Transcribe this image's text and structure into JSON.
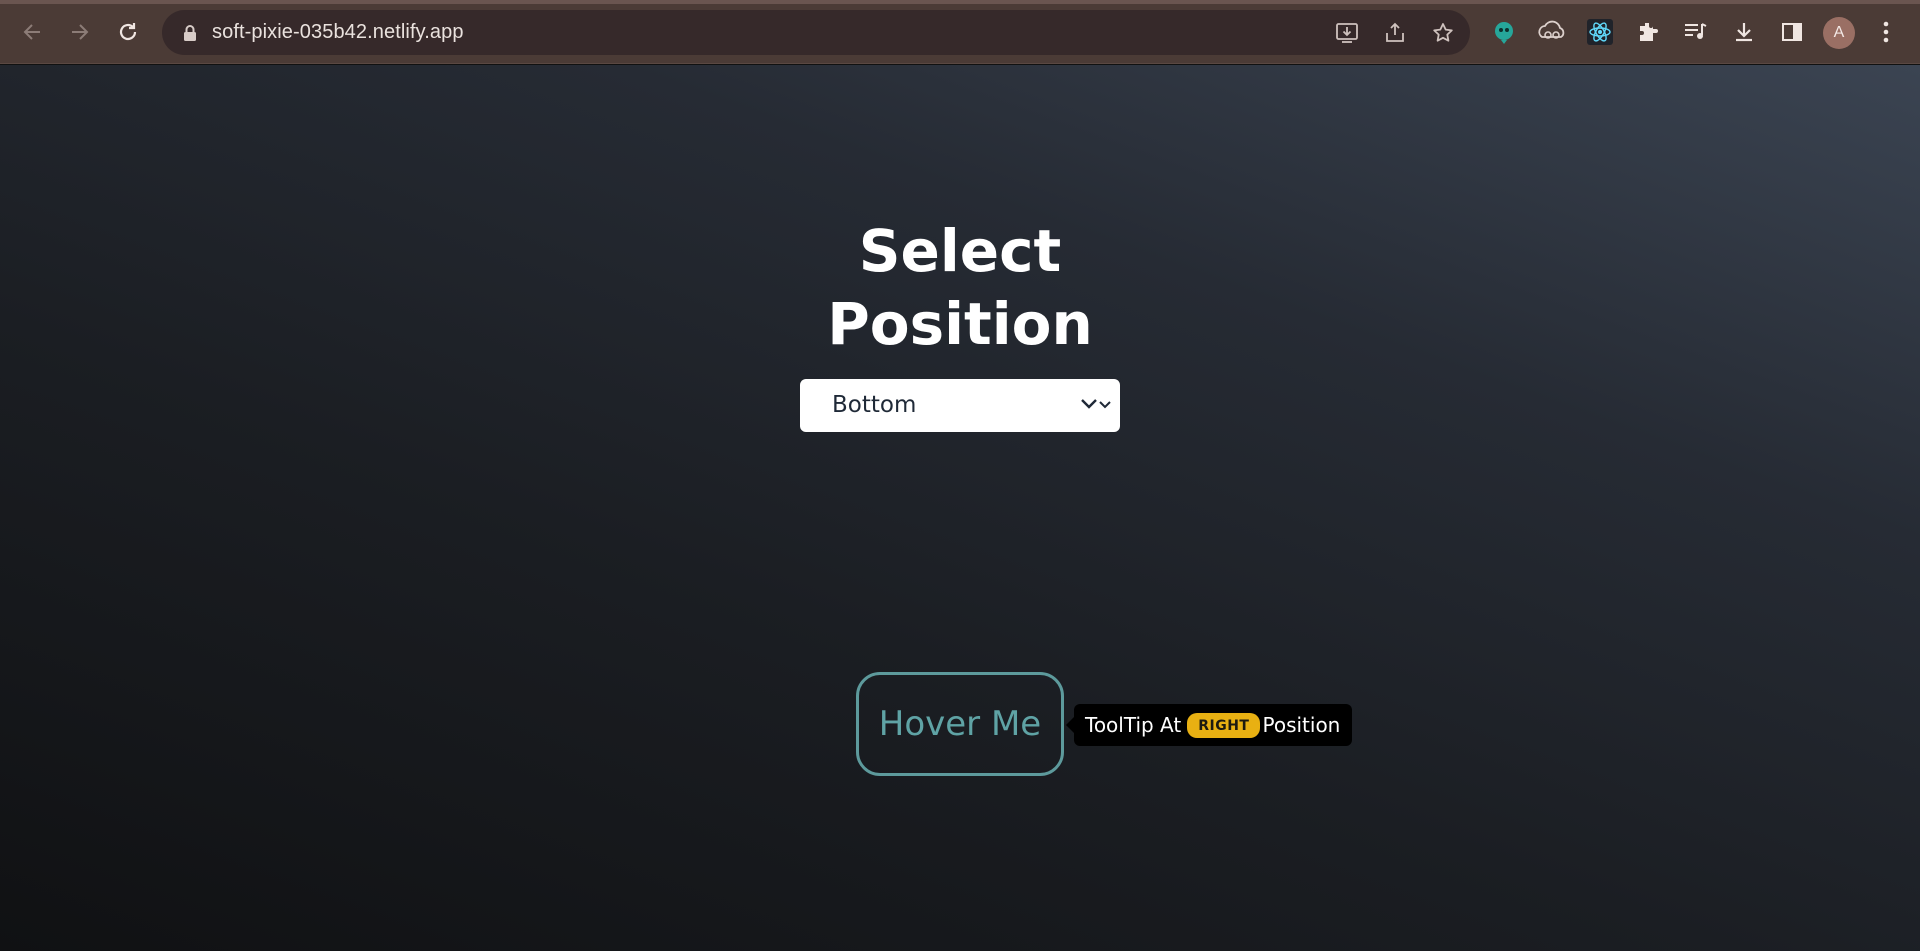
{
  "browser": {
    "url": "soft-pixie-035b42.netlify.app",
    "profile_initial": "A",
    "toolbar_icons": [
      "back-icon",
      "forward-icon",
      "reload-icon",
      "lock-icon",
      "install-app-icon",
      "share-icon",
      "bookmark-star-icon"
    ],
    "extension_icons": [
      "extension-1-icon",
      "extension-2-icon",
      "react-devtools-icon",
      "puzzle-extensions-icon",
      "media-playlist-icon",
      "downloads-icon",
      "side-panel-icon",
      "menu-dots-icon"
    ]
  },
  "page": {
    "title_line1": "Select",
    "title_line2": "Position",
    "select": {
      "selected": "Bottom"
    },
    "hover_button_label": "Hover Me",
    "tooltip": {
      "prefix": "ToolTip At",
      "position_badge": "RIGHT",
      "suffix": "Position"
    }
  },
  "colors": {
    "chrome": "#4b3b36",
    "omnibox": "#36292a",
    "accent_teal": "#5fa3a5",
    "badge_yellow": "#e8b012",
    "tooltip_bg": "#000000"
  }
}
